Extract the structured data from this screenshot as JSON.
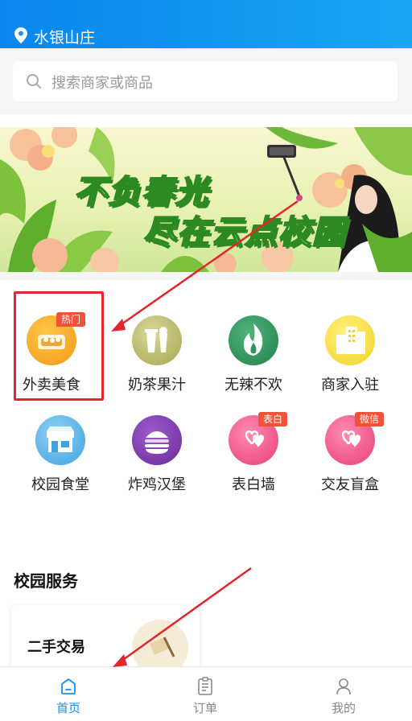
{
  "header": {
    "location": "水银山庄"
  },
  "search": {
    "placeholder": "搜索商家或商品"
  },
  "banner": {
    "line1": "不负春光",
    "line2": "尽在云点校园"
  },
  "categories": [
    {
      "label": "外卖美食",
      "badge": "热门",
      "icon": "food-icon"
    },
    {
      "label": "奶茶果汁",
      "badge": "",
      "icon": "milk-tea-icon"
    },
    {
      "label": "无辣不欢",
      "badge": "",
      "icon": "flame-icon"
    },
    {
      "label": "商家入驻",
      "badge": "",
      "icon": "building-icon"
    },
    {
      "label": "校园食堂",
      "badge": "",
      "icon": "canteen-icon"
    },
    {
      "label": "炸鸡汉堡",
      "badge": "",
      "icon": "burger-icon"
    },
    {
      "label": "表白墙",
      "badge": "表白",
      "icon": "hearts-icon"
    },
    {
      "label": "交友盲盒",
      "badge": "微信",
      "icon": "hearts-icon"
    }
  ],
  "services": {
    "title": "校园服务",
    "card_title": "二手交易"
  },
  "tabbar": {
    "items": [
      {
        "label": "首页",
        "icon": "home-icon",
        "active": true
      },
      {
        "label": "订单",
        "icon": "order-icon",
        "active": false
      },
      {
        "label": "我的",
        "icon": "user-icon",
        "active": false
      }
    ]
  },
  "colors": {
    "accent": "#1a8ff0",
    "header": "#0a86f0",
    "badge": "#f0533a",
    "highlight": "#e3262b"
  }
}
